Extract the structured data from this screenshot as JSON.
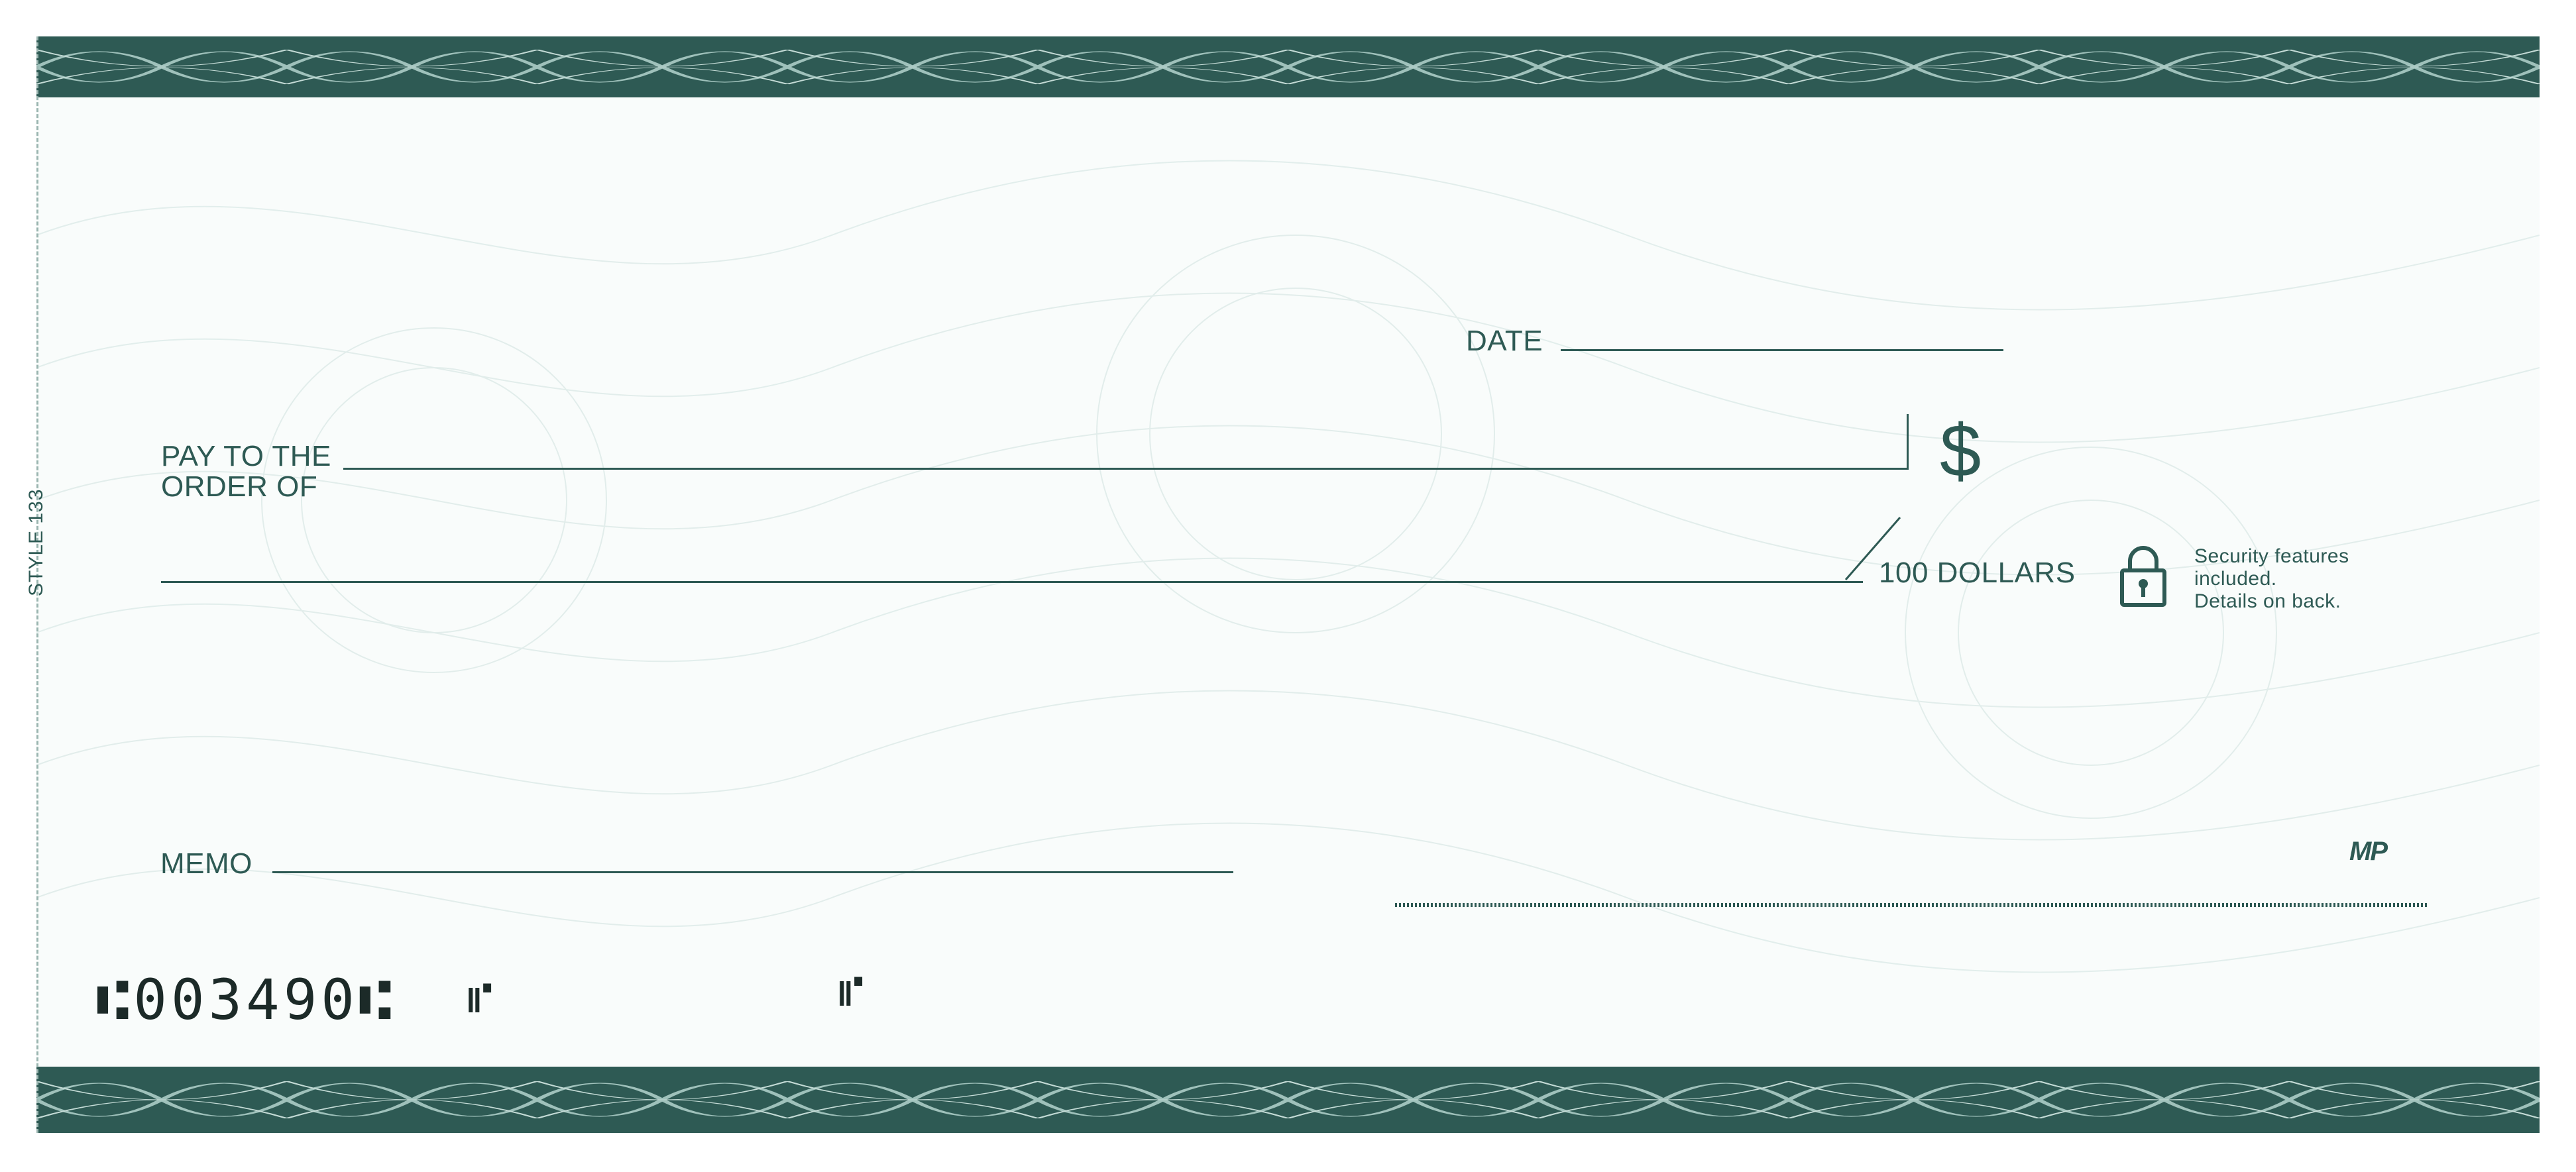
{
  "check": {
    "style_label": "STYLE 133",
    "date_label": "DATE",
    "payee_label_line1": "PAY TO THE",
    "payee_label_line2": "ORDER OF",
    "currency_symbol": "$",
    "dollars_label": "100 DOLLARS",
    "security_text": "Security features\nincluded.\nDetails on back.",
    "memo_label": "MEMO",
    "printer_mark": "MP",
    "micr_number": "⑆003490⑆",
    "micr_suffix": "⑈",
    "micr_extra": "⑈",
    "icons": [
      "lock-icon",
      "guilloche-border-pattern"
    ],
    "colors": {
      "ink": "#2e5a54",
      "paper": "#f9fcfb",
      "micr": "#1c2a28"
    }
  }
}
